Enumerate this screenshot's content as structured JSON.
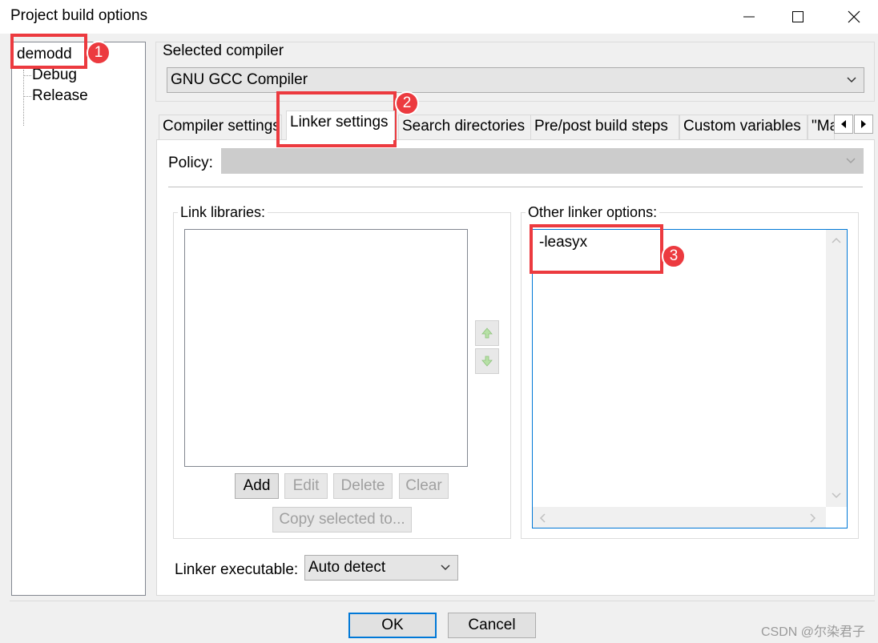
{
  "window": {
    "title": "Project build options",
    "minimize_icon": "minimize-icon",
    "maximize_icon": "maximize-icon",
    "close_icon": "close-icon"
  },
  "tree": {
    "root": "demodd",
    "children": [
      "Debug",
      "Release"
    ]
  },
  "compiler": {
    "label": "Selected compiler",
    "value": "GNU GCC Compiler"
  },
  "tabs": [
    {
      "label": "Compiler settings",
      "active": false
    },
    {
      "label": "Linker settings",
      "active": true
    },
    {
      "label": "Search directories",
      "active": false
    },
    {
      "label": "Pre/post build steps",
      "active": false
    },
    {
      "label": "Custom variables",
      "active": false
    },
    {
      "label": "\"Make\" commands",
      "active": false
    }
  ],
  "policy": {
    "label": "Policy:",
    "value": ""
  },
  "link_libraries": {
    "label": "Link libraries:",
    "items": [],
    "buttons": {
      "add": "Add",
      "edit": "Edit",
      "delete": "Delete",
      "clear": "Clear",
      "copy": "Copy selected to..."
    }
  },
  "other_linker_options": {
    "label": "Other linker options:",
    "value": "-leasyx"
  },
  "linker_executable": {
    "label": "Linker executable:",
    "value": "Auto detect"
  },
  "dialog_buttons": {
    "ok": "OK",
    "cancel": "Cancel"
  },
  "annotations": {
    "badge1": "1",
    "badge2": "2",
    "badge3": "3",
    "highlight_color": "#ec3a3f"
  },
  "watermark": "CSDN @尔染君子"
}
